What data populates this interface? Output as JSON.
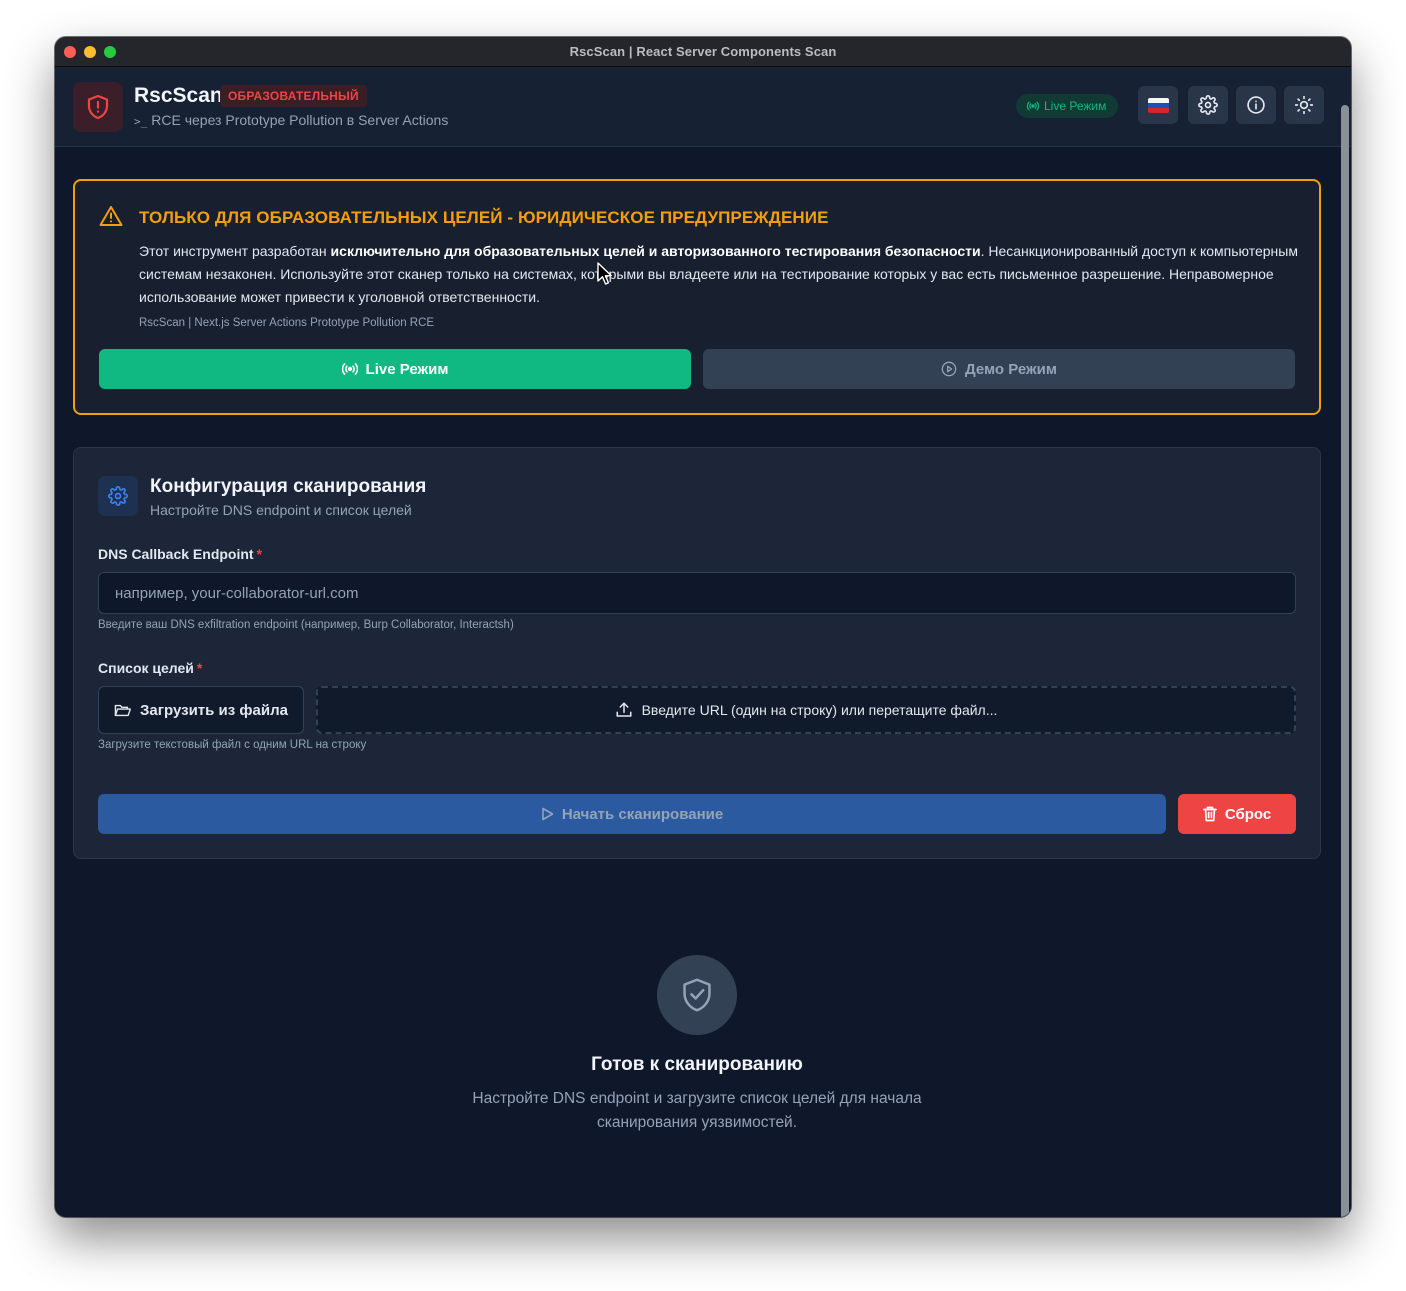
{
  "window": {
    "title": "RscScan | React Server Components Scan"
  },
  "header": {
    "app_name": "RscScan",
    "badge": "ОБРАЗОВАТЕЛЬНЫЙ",
    "prompt_symbol": ">_",
    "subtitle": "RCE через Prototype Pollution в Server Actions",
    "mode_pill": "Live Режим",
    "buttons": [
      "language-ru",
      "settings",
      "info",
      "theme-toggle"
    ]
  },
  "warning": {
    "title": "ТОЛЬКО ДЛЯ ОБРАЗОВАТЕЛЬНЫХ ЦЕЛЕЙ - ЮРИДИЧЕСКОЕ ПРЕДУПРЕЖДЕНИЕ",
    "text_before": "Этот инструмент разработан ",
    "text_bold": "исключительно для образовательных целей и авторизованного тестирования безопасности",
    "text_after": ". Несанкционированный доступ к компьютерным системам незаконен. Используйте этот сканер только на системах, которыми вы владеете или на тестирование которых у вас есть письменное разрешение. Неправомерное использование может привести к уголовной ответственности.",
    "footer": "RscScan | Next.js Server Actions Prototype Pollution RCE",
    "live_button": "Live Режим",
    "demo_button": "Демо Режим"
  },
  "config": {
    "title": "Конфигурация сканирования",
    "subtitle": "Настройте DNS endpoint и список целей",
    "dns_label": "DNS Callback Endpoint",
    "required_mark": "*",
    "dns_value": "",
    "dns_placeholder": "например, your-collaborator-url.com",
    "dns_hint": "Введите ваш DNS exfiltration endpoint (например, Burp Collaborator, Interactsh)",
    "targets_label": "Список целей",
    "upload_button": "Загрузить из файла",
    "dropzone_text": "Введите URL (один на строку) или перетащите файл...",
    "targets_hint": "Загрузите текстовый файл с одним URL на строку",
    "start_button": "Начать сканирование",
    "reset_button": "Сброс"
  },
  "ready": {
    "title": "Готов к сканированию",
    "text": "Настройте DNS endpoint и загрузите список целей для начала сканирования уязвимостей."
  },
  "colors": {
    "background": "#0f172a",
    "card": "#1c2638",
    "accent_green": "#10b981",
    "warning": "#f59e0b",
    "danger": "#ef4444",
    "primary": "#2c5aa0"
  },
  "icons": {
    "logo": "shield-alert-icon",
    "pill": "broadcast-icon",
    "settings": "gear-icon",
    "info": "info-icon",
    "theme": "sun-icon",
    "warning": "warning-triangle-icon",
    "demo": "play-circle-icon",
    "upload": "folder-open-icon",
    "dropzone": "upload-icon",
    "start": "play-icon",
    "reset": "trash-icon",
    "ready": "shield-check-icon"
  }
}
